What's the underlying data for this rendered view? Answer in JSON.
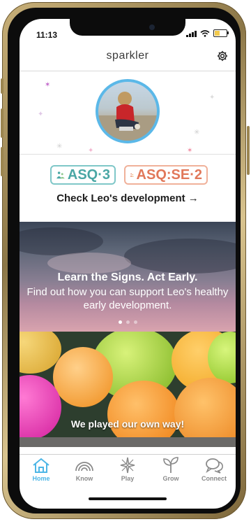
{
  "status_bar": {
    "time": "11:13"
  },
  "header": {
    "logo": "sparkler",
    "settings_icon": "gear-icon"
  },
  "profile": {
    "avatar": "child-photo"
  },
  "asq": {
    "badges": [
      {
        "label": "ASQ·3",
        "color": "#4aa7a5"
      },
      {
        "label": "ASQ:SE·2",
        "color": "#e1785a"
      }
    ],
    "check_link": "Check Leo's development →"
  },
  "banners": [
    {
      "title": "Learn the Signs. Act Early.",
      "subtitle": "Find out how you can support Leo's healthy early development."
    },
    {
      "caption": "We played our own way!"
    }
  ],
  "carousel": {
    "pages": 3,
    "active": 1
  },
  "tab_bar": {
    "active_color": "#4db6e6",
    "tabs": [
      {
        "label": "Home",
        "icon": "home-icon",
        "active": true
      },
      {
        "label": "Know",
        "icon": "rainbow-icon",
        "active": false
      },
      {
        "label": "Play",
        "icon": "sparkle-icon",
        "active": false
      },
      {
        "label": "Grow",
        "icon": "sprout-icon",
        "active": false
      },
      {
        "label": "Connect",
        "icon": "chat-bubbles-icon",
        "active": false
      }
    ]
  }
}
